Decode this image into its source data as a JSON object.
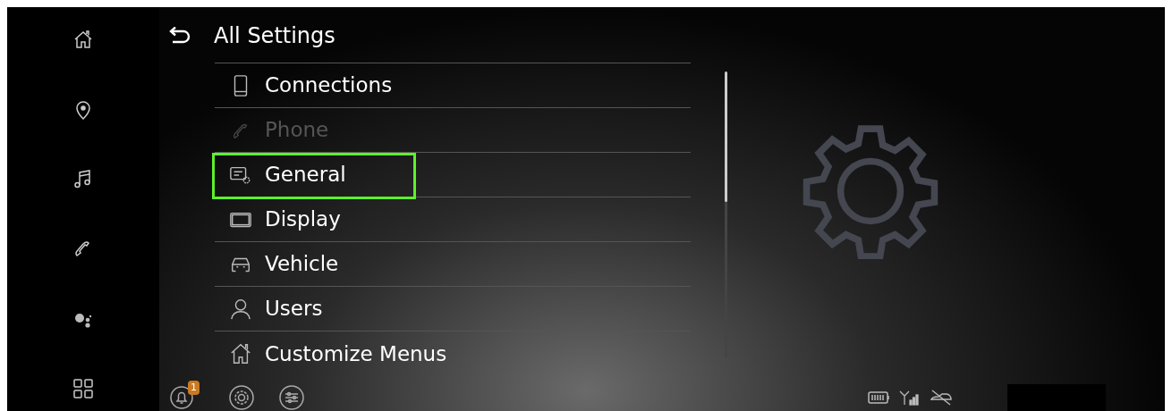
{
  "header": {
    "title": "All Settings"
  },
  "sidebar": {
    "items": [
      {
        "kind": "home"
      },
      {
        "kind": "location"
      },
      {
        "kind": "music"
      },
      {
        "kind": "phone"
      },
      {
        "kind": "assistant"
      },
      {
        "kind": "apps"
      }
    ]
  },
  "menu": [
    {
      "label": "Connections",
      "kind": "device",
      "disabled": false,
      "highlighted": false
    },
    {
      "label": "Phone",
      "kind": "phone",
      "disabled": true,
      "highlighted": false
    },
    {
      "label": "General",
      "kind": "general",
      "disabled": false,
      "highlighted": true
    },
    {
      "label": "Display",
      "kind": "display",
      "disabled": false,
      "highlighted": false
    },
    {
      "label": "Vehicle",
      "kind": "vehicle",
      "disabled": false,
      "highlighted": false
    },
    {
      "label": "Users",
      "kind": "user",
      "disabled": false,
      "highlighted": false
    },
    {
      "label": "Customize Menus",
      "kind": "home",
      "disabled": false,
      "highlighted": false
    }
  ],
  "bottom_bar": {
    "notification_count": "1"
  }
}
